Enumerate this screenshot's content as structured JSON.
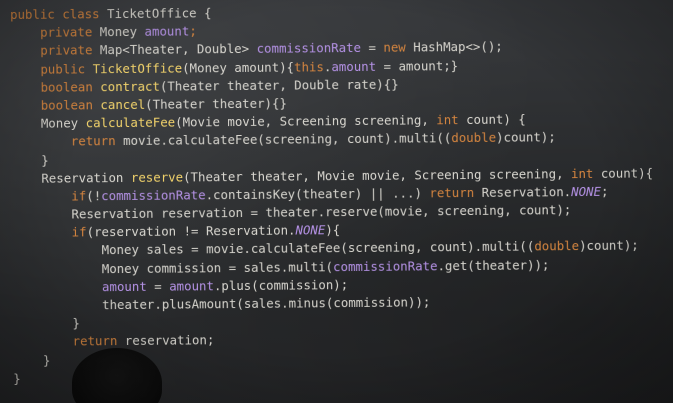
{
  "code": {
    "lines": [
      [
        [
          "public class ",
          "kw"
        ],
        [
          "TicketOffice {",
          "hdr"
        ]
      ],
      [
        [
          "    private ",
          "kw"
        ],
        [
          "Money ",
          "type"
        ],
        [
          "amount",
          "field"
        ],
        [
          ";",
          "kw"
        ]
      ],
      [
        [
          "    private ",
          "kw"
        ],
        [
          "Map<Theater, Double> ",
          "type"
        ],
        [
          "commissionRate",
          "field"
        ],
        [
          " = ",
          "type"
        ],
        [
          "new ",
          "kw"
        ],
        [
          "HashMap<>();",
          "type"
        ]
      ],
      [
        [
          "    public ",
          "kw"
        ],
        [
          "TicketOffice",
          "fn"
        ],
        [
          "(Money amount){",
          "type"
        ],
        [
          "this",
          "kw"
        ],
        [
          ".",
          "type"
        ],
        [
          "amount",
          "field"
        ],
        [
          " = amount;}",
          "type"
        ]
      ],
      [
        [
          "    boolean ",
          "kw"
        ],
        [
          "contract",
          "fn"
        ],
        [
          "(Theater theater, Double rate){}",
          "type"
        ]
      ],
      [
        [
          "    boolean ",
          "kw"
        ],
        [
          "cancel",
          "fn"
        ],
        [
          "(Theater theater){}",
          "type"
        ]
      ],
      [
        [
          "    Money ",
          "type"
        ],
        [
          "calculateFee",
          "fn"
        ],
        [
          "(Movie movie, Screening screening, ",
          "type"
        ],
        [
          "int ",
          "kw"
        ],
        [
          "count) {",
          "type"
        ]
      ],
      [
        [
          "        return ",
          "kw"
        ],
        [
          "movie.calculateFee(screening, count).multi((",
          "type"
        ],
        [
          "double",
          "kw"
        ],
        [
          ")count);",
          "type"
        ]
      ],
      [
        [
          "    }",
          "type"
        ]
      ],
      [
        [
          "    Reservation ",
          "type"
        ],
        [
          "reserve",
          "fn"
        ],
        [
          "(Theater theater, Movie movie, Screening screening, ",
          "type"
        ],
        [
          "int ",
          "kw"
        ],
        [
          "count){",
          "type"
        ]
      ],
      [
        [
          "        if",
          "kw"
        ],
        [
          "(!",
          "type"
        ],
        [
          "commissionRate",
          "field"
        ],
        [
          ".containsKey(theater) || ...) ",
          "type"
        ],
        [
          "return ",
          "kw"
        ],
        [
          "Reservation.",
          "type"
        ],
        [
          "NONE",
          "it"
        ],
        [
          ";",
          "type"
        ]
      ],
      [
        [
          "        Reservation reservation = theater.reserve(movie, screening, count);",
          "type"
        ]
      ],
      [
        [
          "        if",
          "kw"
        ],
        [
          "(reservation != Reservation.",
          "type"
        ],
        [
          "NONE",
          "it"
        ],
        [
          "){",
          "type"
        ]
      ],
      [
        [
          "            Money sales = movie.calculateFee(screening, count).multi((",
          "type"
        ],
        [
          "double",
          "kw"
        ],
        [
          ")count);",
          "type"
        ]
      ],
      [
        [
          "            Money commission = sales.multi(",
          "type"
        ],
        [
          "commissionRate",
          "field"
        ],
        [
          ".get(theater));",
          "type"
        ]
      ],
      [
        [
          "            ",
          "type"
        ],
        [
          "amount",
          "field"
        ],
        [
          " = ",
          "type"
        ],
        [
          "amount",
          "field"
        ],
        [
          ".plus(commission);",
          "type"
        ]
      ],
      [
        [
          "            theater.plusAmount(sales.minus(commission));",
          "type"
        ]
      ],
      [
        [
          "        }",
          "type"
        ]
      ],
      [
        [
          "        return ",
          "kw"
        ],
        [
          "reservation;",
          "type"
        ]
      ],
      [
        [
          "    }",
          "type"
        ]
      ],
      [
        [
          "}",
          "type"
        ]
      ]
    ]
  },
  "colors": {
    "keyword": "#d5853f",
    "method": "#f2d36b",
    "field": "#b592e6",
    "text": "#d8d6cf",
    "background": "#2e3032"
  }
}
